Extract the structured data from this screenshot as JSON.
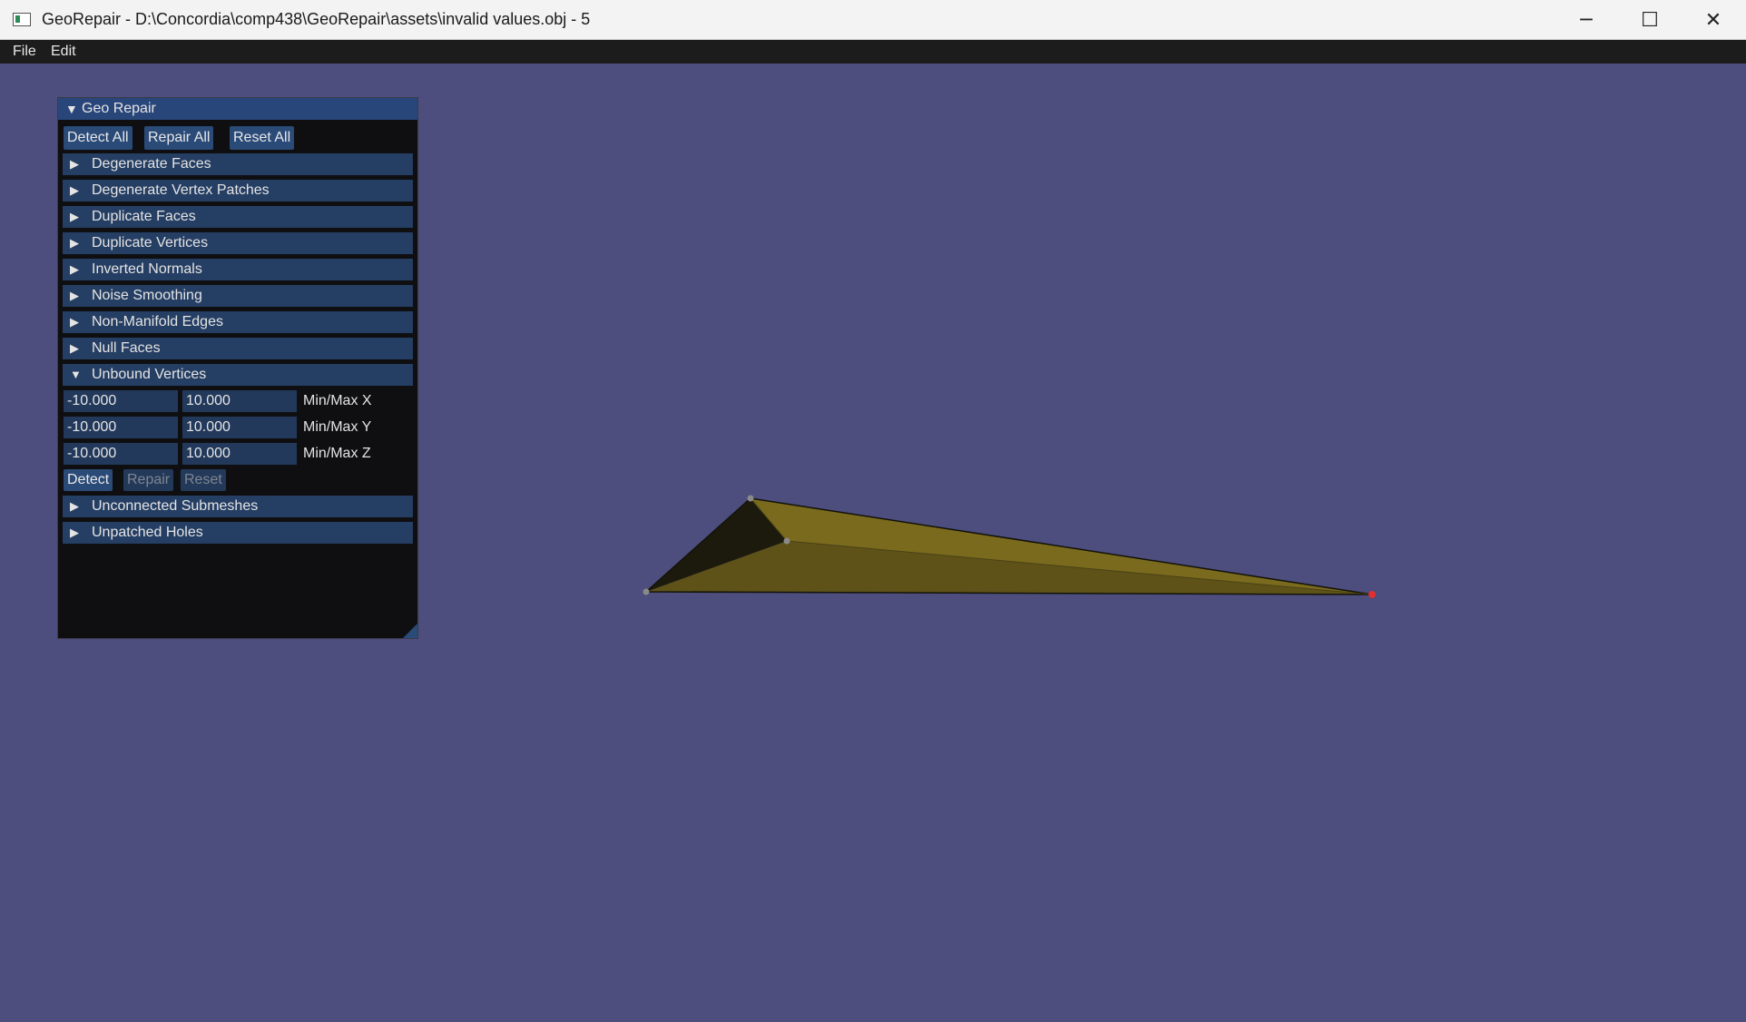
{
  "window": {
    "title": "GeoRepair - D:\\Concordia\\comp438\\GeoRepair\\assets\\invalid values.obj - 5",
    "minimize_glyph": "─",
    "maximize_glyph": "☐",
    "close_glyph": "✕"
  },
  "menu": {
    "file": "File",
    "edit": "Edit"
  },
  "panel": {
    "title": "Geo Repair",
    "expanded_glyph": "▼",
    "collapsed_glyph": "▶",
    "detect_all": "Detect All",
    "repair_all": "Repair All",
    "reset_all": "Reset All",
    "sections": [
      "Degenerate Faces",
      "Degenerate Vertex Patches",
      "Duplicate Faces",
      "Duplicate Vertices",
      "Inverted Normals",
      "Noise Smoothing",
      "Non-Manifold Edges",
      "Null Faces",
      "Unbound Vertices",
      "Unconnected Submeshes",
      "Unpatched Holes"
    ],
    "unbound": {
      "x_min": "-10.000",
      "x_max": "10.000",
      "x_label": "Min/Max X",
      "y_min": "-10.000",
      "y_max": "10.000",
      "y_label": "Min/Max Y",
      "z_min": "-10.000",
      "z_max": "10.000",
      "z_label": "Min/Max Z",
      "detect": "Detect",
      "repair": "Repair",
      "reset": "Reset"
    }
  },
  "colors": {
    "viewport_bg": "#4d4d7e",
    "mesh_light": "#7a6a1e",
    "mesh_dark": "#1b1a0c",
    "highlight_vertex": "#e03030"
  }
}
